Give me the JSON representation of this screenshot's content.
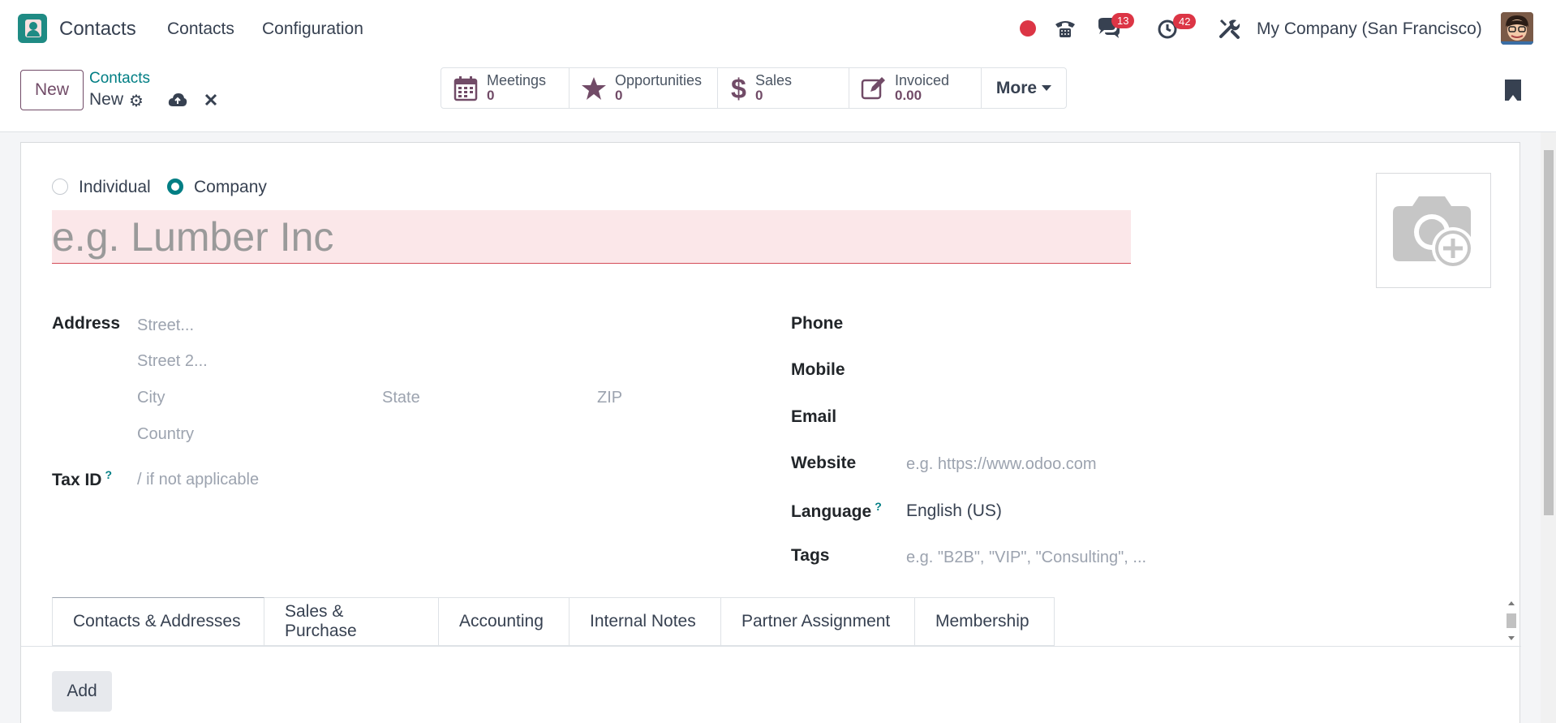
{
  "navbar": {
    "app_name": "Contacts",
    "menu": [
      "Contacts",
      "Configuration"
    ],
    "messages_badge": "13",
    "activities_badge": "42",
    "company": "My Company (San Francisco)"
  },
  "control_panel": {
    "new_label": "New",
    "breadcrumb_parent": "Contacts",
    "breadcrumb_current": "New",
    "more_label": "More",
    "smart_buttons": [
      {
        "label": "Meetings",
        "value": "0",
        "icon": "calendar-icon"
      },
      {
        "label": "Opportunities",
        "value": "0",
        "icon": "star-icon"
      },
      {
        "label": "Sales",
        "value": "0",
        "icon": "dollar-icon"
      },
      {
        "label": "Invoiced",
        "value": "0.00",
        "icon": "edit-icon"
      }
    ]
  },
  "form": {
    "type_individual": "Individual",
    "type_company": "Company",
    "selected_type": "Company",
    "name_placeholder": "e.g. Lumber Inc",
    "address_label": "Address",
    "street_placeholder": "Street...",
    "street2_placeholder": "Street 2...",
    "city_placeholder": "City",
    "state_placeholder": "State",
    "zip_placeholder": "ZIP",
    "country_placeholder": "Country",
    "taxid_label": "Tax ID",
    "taxid_placeholder": "/ if not applicable",
    "help_mark": "?",
    "phone_label": "Phone",
    "mobile_label": "Mobile",
    "email_label": "Email",
    "website_label": "Website",
    "website_placeholder": "e.g. https://www.odoo.com",
    "language_label": "Language",
    "language_value": "English (US)",
    "tags_label": "Tags",
    "tags_placeholder": "e.g. \"B2B\", \"VIP\", \"Consulting\", ..."
  },
  "tabs": [
    "Contacts & Addresses",
    "Sales & Purchase",
    "Accounting",
    "Internal Notes",
    "Partner Assignment",
    "Membership"
  ],
  "add_label": "Add",
  "colors": {
    "brand": "#714b67",
    "accent": "#017e84",
    "badge": "#dc3545",
    "required_bg": "#fbe7e9"
  }
}
